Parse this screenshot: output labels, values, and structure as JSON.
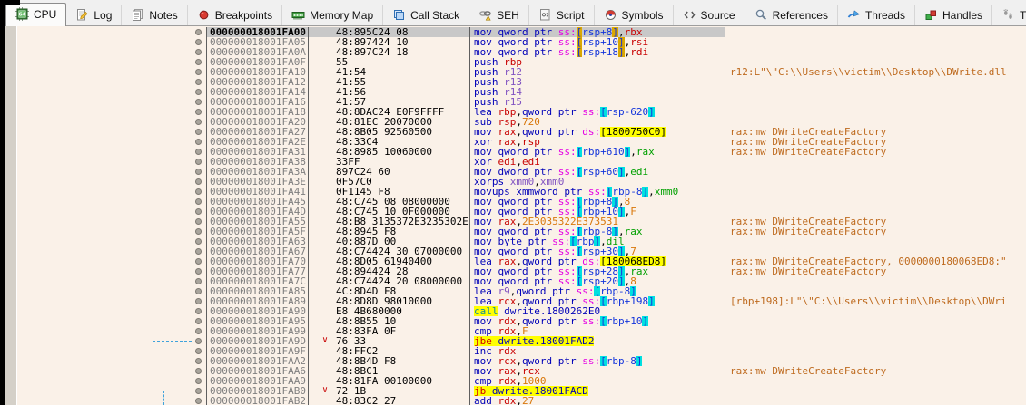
{
  "app": "x64dbg debugger - CPU disassembly view",
  "colors": {
    "pane_bg": "#FAF1E8",
    "selection_bg": "#C8C8C8",
    "comment_text": "#BE6A1E",
    "highlight_yellow": "#FFFF00",
    "bracket_gold": "#DBA800",
    "bracket_cyan": "#00E0E0",
    "jump_line_blue": "#3FA3DC",
    "jump_arrow_red": "#C80000",
    "register_red": "#C80000",
    "register_green": "#00A000",
    "register_purple": "#8153C1",
    "mnemonic_blue": "#0000B8",
    "segment_magenta": "#E400E4",
    "number_orange": "#D9770A"
  },
  "tabs": [
    {
      "label": "CPU",
      "icon": "cpu-icon",
      "active": true
    },
    {
      "label": "Log",
      "icon": "log-icon",
      "active": false
    },
    {
      "label": "Notes",
      "icon": "notes-icon",
      "active": false
    },
    {
      "label": "Breakpoints",
      "icon": "breakpoints-icon",
      "active": false
    },
    {
      "label": "Memory Map",
      "icon": "memory-map-icon",
      "active": false
    },
    {
      "label": "Call Stack",
      "icon": "call-stack-icon",
      "active": false
    },
    {
      "label": "SEH",
      "icon": "seh-icon",
      "active": false
    },
    {
      "label": "Script",
      "icon": "script-icon",
      "active": false
    },
    {
      "label": "Symbols",
      "icon": "symbols-icon",
      "active": false
    },
    {
      "label": "Source",
      "icon": "source-icon",
      "active": false
    },
    {
      "label": "References",
      "icon": "references-icon",
      "active": false
    },
    {
      "label": "Threads",
      "icon": "threads-icon",
      "active": false
    },
    {
      "label": "Handles",
      "icon": "handles-icon",
      "active": false
    },
    {
      "label": "Trace",
      "icon": "trace-icon",
      "active": false
    }
  ],
  "disasm": {
    "rows": [
      {
        "a": "000000018001FA00",
        "b": "48:895C24 08",
        "sel": true,
        "t": [
          [
            "mn",
            "mov qword ptr "
          ],
          [
            "sg",
            "ss:"
          ],
          [
            "gb",
            "["
          ],
          [
            "br",
            "rsp+8"
          ],
          [
            "gb",
            "]"
          ],
          [
            "pl",
            ","
          ],
          [
            "rr",
            "rbx"
          ]
        ],
        "c": ""
      },
      {
        "a": "000000018001FA05",
        "b": "48:897424 10",
        "t": [
          [
            "mn",
            "mov qword ptr "
          ],
          [
            "sg",
            "ss:"
          ],
          [
            "gb",
            "["
          ],
          [
            "br",
            "rsp+10"
          ],
          [
            "gb",
            "]"
          ],
          [
            "pl",
            ","
          ],
          [
            "rr",
            "rsi"
          ]
        ],
        "c": ""
      },
      {
        "a": "000000018001FA0A",
        "b": "48:897C24 18",
        "t": [
          [
            "mn",
            "mov qword ptr "
          ],
          [
            "sg",
            "ss:"
          ],
          [
            "gb",
            "["
          ],
          [
            "br",
            "rsp+18"
          ],
          [
            "gb",
            "]"
          ],
          [
            "pl",
            ","
          ],
          [
            "rr",
            "rdi"
          ]
        ],
        "c": ""
      },
      {
        "a": "000000018001FA0F",
        "b": "55",
        "t": [
          [
            "mn",
            "push "
          ],
          [
            "rr",
            "rbp"
          ]
        ],
        "c": ""
      },
      {
        "a": "000000018001FA10",
        "b": "41:54",
        "t": [
          [
            "mn",
            "push "
          ],
          [
            "rp",
            "r12"
          ]
        ],
        "c": "r12:L\"\\\"C:\\\\Users\\\\victim\\\\Desktop\\\\DWrite.dll"
      },
      {
        "a": "000000018001FA12",
        "b": "41:55",
        "t": [
          [
            "mn",
            "push "
          ],
          [
            "rp",
            "r13"
          ]
        ],
        "c": ""
      },
      {
        "a": "000000018001FA14",
        "b": "41:56",
        "t": [
          [
            "mn",
            "push "
          ],
          [
            "rp",
            "r14"
          ]
        ],
        "c": ""
      },
      {
        "a": "000000018001FA16",
        "b": "41:57",
        "t": [
          [
            "mn",
            "push "
          ],
          [
            "rp",
            "r15"
          ]
        ],
        "c": ""
      },
      {
        "a": "000000018001FA18",
        "b": "48:8DAC24 E0F9FFFF",
        "t": [
          [
            "mn",
            "lea "
          ],
          [
            "rr",
            "rbp"
          ],
          [
            "pl",
            ","
          ],
          [
            "mn",
            "qword ptr "
          ],
          [
            "sg",
            "ss:"
          ],
          [
            "cb",
            "["
          ],
          [
            "br",
            "rsp-620"
          ],
          [
            "cb",
            "]"
          ]
        ],
        "c": ""
      },
      {
        "a": "000000018001FA20",
        "b": "48:81EC 20070000",
        "t": [
          [
            "mn",
            "sub "
          ],
          [
            "rr",
            "rsp"
          ],
          [
            "pl",
            ","
          ],
          [
            "nm",
            "720"
          ]
        ],
        "c": ""
      },
      {
        "a": "000000018001FA27",
        "b": "48:8B05 92560500",
        "t": [
          [
            "mn",
            "mov "
          ],
          [
            "rr",
            "rax"
          ],
          [
            "pl",
            ","
          ],
          [
            "mn",
            "qword ptr "
          ],
          [
            "sg",
            "ds:"
          ],
          [
            "my",
            "[1800750C0]"
          ]
        ],
        "c": "rax:mw_DWriteCreateFactory"
      },
      {
        "a": "000000018001FA2E",
        "b": "48:33C4",
        "t": [
          [
            "mn",
            "xor "
          ],
          [
            "rr",
            "rax"
          ],
          [
            "pl",
            ","
          ],
          [
            "rr",
            "rsp"
          ]
        ],
        "c": "rax:mw_DWriteCreateFactory"
      },
      {
        "a": "000000018001FA31",
        "b": "48:8985 10060000",
        "t": [
          [
            "mn",
            "mov qword ptr "
          ],
          [
            "sg",
            "ss:"
          ],
          [
            "cb",
            "["
          ],
          [
            "br",
            "rbp+610"
          ],
          [
            "cb",
            "]"
          ],
          [
            "pl",
            ","
          ],
          [
            "rg",
            "rax"
          ]
        ],
        "c": "rax:mw_DWriteCreateFactory"
      },
      {
        "a": "000000018001FA38",
        "b": "33FF",
        "t": [
          [
            "mn",
            "xor "
          ],
          [
            "rr",
            "edi"
          ],
          [
            "pl",
            ","
          ],
          [
            "rr",
            "edi"
          ]
        ],
        "c": ""
      },
      {
        "a": "000000018001FA3A",
        "b": "897C24 60",
        "t": [
          [
            "mn",
            "mov dword ptr "
          ],
          [
            "sg",
            "ss:"
          ],
          [
            "cb",
            "["
          ],
          [
            "br",
            "rsp+60"
          ],
          [
            "cb",
            "]"
          ],
          [
            "pl",
            ","
          ],
          [
            "rg",
            "edi"
          ]
        ],
        "c": ""
      },
      {
        "a": "000000018001FA3E",
        "b": "0F57C0",
        "t": [
          [
            "mn",
            "xorps "
          ],
          [
            "rp",
            "xmm0"
          ],
          [
            "pl",
            ","
          ],
          [
            "rp",
            "xmm0"
          ]
        ],
        "c": ""
      },
      {
        "a": "000000018001FA41",
        "b": "0F1145 F8",
        "t": [
          [
            "mn",
            "movups xmmword ptr "
          ],
          [
            "sg",
            "ss:"
          ],
          [
            "cb",
            "["
          ],
          [
            "br",
            "rbp-8"
          ],
          [
            "cb",
            "]"
          ],
          [
            "pl",
            ","
          ],
          [
            "rg",
            "xmm0"
          ]
        ],
        "c": ""
      },
      {
        "a": "000000018001FA45",
        "b": "48:C745 08 08000000",
        "t": [
          [
            "mn",
            "mov qword ptr "
          ],
          [
            "sg",
            "ss:"
          ],
          [
            "cb",
            "["
          ],
          [
            "br",
            "rbp+8"
          ],
          [
            "cb",
            "]"
          ],
          [
            "pl",
            ","
          ],
          [
            "nm",
            "8"
          ]
        ],
        "c": ""
      },
      {
        "a": "000000018001FA4D",
        "b": "48:C745 10 0F000000",
        "t": [
          [
            "mn",
            "mov qword ptr "
          ],
          [
            "sg",
            "ss:"
          ],
          [
            "cb",
            "["
          ],
          [
            "br",
            "rbp+10"
          ],
          [
            "cb",
            "]"
          ],
          [
            "pl",
            ","
          ],
          [
            "nm",
            "F"
          ]
        ],
        "c": ""
      },
      {
        "a": "000000018001FA55",
        "b": "48:B8 3135372E3235302E",
        "t": [
          [
            "mn",
            "mov "
          ],
          [
            "rr",
            "rax"
          ],
          [
            "pl",
            ","
          ],
          [
            "nm",
            "2E3035322E373531"
          ]
        ],
        "c": "rax:mw_DWriteCreateFactory"
      },
      {
        "a": "000000018001FA5F",
        "b": "48:8945 F8",
        "t": [
          [
            "mn",
            "mov qword ptr "
          ],
          [
            "sg",
            "ss:"
          ],
          [
            "cb",
            "["
          ],
          [
            "br",
            "rbp-8"
          ],
          [
            "cb",
            "]"
          ],
          [
            "pl",
            ","
          ],
          [
            "rg",
            "rax"
          ]
        ],
        "c": "rax:mw_DWriteCreateFactory"
      },
      {
        "a": "000000018001FA63",
        "b": "40:887D 00",
        "t": [
          [
            "mn",
            "mov byte ptr "
          ],
          [
            "sg",
            "ss:"
          ],
          [
            "cb",
            "["
          ],
          [
            "br",
            "rbp"
          ],
          [
            "cb",
            "]"
          ],
          [
            "pl",
            ","
          ],
          [
            "rg",
            "dil"
          ]
        ],
        "c": ""
      },
      {
        "a": "000000018001FA67",
        "b": "48:C74424 30 07000000",
        "t": [
          [
            "mn",
            "mov qword ptr "
          ],
          [
            "sg",
            "ss:"
          ],
          [
            "cb",
            "["
          ],
          [
            "br",
            "rsp+30"
          ],
          [
            "cb",
            "]"
          ],
          [
            "pl",
            ","
          ],
          [
            "nm",
            "7"
          ]
        ],
        "c": ""
      },
      {
        "a": "000000018001FA70",
        "b": "48:8D05 61940400",
        "t": [
          [
            "mn",
            "lea "
          ],
          [
            "rr",
            "rax"
          ],
          [
            "pl",
            ","
          ],
          [
            "mn",
            "qword ptr "
          ],
          [
            "sg",
            "ds:"
          ],
          [
            "my",
            "[180068ED8]"
          ]
        ],
        "c": "rax:mw_DWriteCreateFactory, 0000000180068ED8:\""
      },
      {
        "a": "000000018001FA77",
        "b": "48:894424 28",
        "t": [
          [
            "mn",
            "mov qword ptr "
          ],
          [
            "sg",
            "ss:"
          ],
          [
            "cb",
            "["
          ],
          [
            "br",
            "rsp+28"
          ],
          [
            "cb",
            "]"
          ],
          [
            "pl",
            ","
          ],
          [
            "rg",
            "rax"
          ]
        ],
        "c": "rax:mw_DWriteCreateFactory"
      },
      {
        "a": "000000018001FA7C",
        "b": "48:C74424 20 08000000",
        "t": [
          [
            "mn",
            "mov qword ptr "
          ],
          [
            "sg",
            "ss:"
          ],
          [
            "cb",
            "["
          ],
          [
            "br",
            "rsp+20"
          ],
          [
            "cb",
            "]"
          ],
          [
            "pl",
            ","
          ],
          [
            "nm",
            "8"
          ]
        ],
        "c": ""
      },
      {
        "a": "000000018001FA85",
        "b": "4C:8D4D F8",
        "t": [
          [
            "mn",
            "lea "
          ],
          [
            "rp",
            "r9"
          ],
          [
            "pl",
            ","
          ],
          [
            "mn",
            "qword ptr "
          ],
          [
            "sg",
            "ss:"
          ],
          [
            "cb",
            "["
          ],
          [
            "br",
            "rbp-8"
          ],
          [
            "cb",
            "]"
          ]
        ],
        "c": ""
      },
      {
        "a": "000000018001FA89",
        "b": "48:8D8D 98010000",
        "t": [
          [
            "mn",
            "lea "
          ],
          [
            "rr",
            "rcx"
          ],
          [
            "pl",
            ","
          ],
          [
            "mn",
            "qword ptr "
          ],
          [
            "sg",
            "ss:"
          ],
          [
            "cb",
            "["
          ],
          [
            "br",
            "rbp+198"
          ],
          [
            "cb",
            "]"
          ]
        ],
        "c": "[rbp+198]:L\"\\\"C:\\\\Users\\\\victim\\\\Desktop\\\\DWri"
      },
      {
        "a": "000000018001FA90",
        "b": "E8 4B680000",
        "t": [
          [
            "cm",
            "call"
          ],
          [
            "pl",
            " "
          ],
          [
            "lb",
            "dwrite.1800262E0"
          ]
        ],
        "c": ""
      },
      {
        "a": "000000018001FA95",
        "b": "48:8B55 10",
        "t": [
          [
            "mn",
            "mov "
          ],
          [
            "rr",
            "rdx"
          ],
          [
            "pl",
            ","
          ],
          [
            "mn",
            "qword ptr "
          ],
          [
            "sg",
            "ss:"
          ],
          [
            "cb",
            "["
          ],
          [
            "br",
            "rbp+10"
          ],
          [
            "cb",
            "]"
          ]
        ],
        "c": ""
      },
      {
        "a": "000000018001FA99",
        "b": "48:83FA 0F",
        "t": [
          [
            "mn",
            "cmp "
          ],
          [
            "rr",
            "rdx"
          ],
          [
            "pl",
            ","
          ],
          [
            "nm",
            "F"
          ]
        ],
        "c": ""
      },
      {
        "a": "000000018001FA9D",
        "b": "76 33",
        "ar": true,
        "t": [
          [
            "jc",
            "jbe"
          ],
          [
            "yp",
            " "
          ],
          [
            "jl",
            "dwrite.18001FAD2"
          ]
        ],
        "c": ""
      },
      {
        "a": "000000018001FA9F",
        "b": "48:FFC2",
        "t": [
          [
            "mn",
            "inc "
          ],
          [
            "rr",
            "rdx"
          ]
        ],
        "c": ""
      },
      {
        "a": "000000018001FAA2",
        "b": "48:8B4D F8",
        "t": [
          [
            "mn",
            "mov "
          ],
          [
            "rr",
            "rcx"
          ],
          [
            "pl",
            ","
          ],
          [
            "mn",
            "qword ptr "
          ],
          [
            "sg",
            "ss:"
          ],
          [
            "cb",
            "["
          ],
          [
            "br",
            "rbp-8"
          ],
          [
            "cb",
            "]"
          ]
        ],
        "c": ""
      },
      {
        "a": "000000018001FAA6",
        "b": "48:8BC1",
        "t": [
          [
            "mn",
            "mov "
          ],
          [
            "rr",
            "rax"
          ],
          [
            "pl",
            ","
          ],
          [
            "rr",
            "rcx"
          ]
        ],
        "c": "rax:mw_DWriteCreateFactory"
      },
      {
        "a": "000000018001FAA9",
        "b": "48:81FA 00100000",
        "t": [
          [
            "mn",
            "cmp "
          ],
          [
            "rr",
            "rdx"
          ],
          [
            "pl",
            ","
          ],
          [
            "nm",
            "1000"
          ]
        ],
        "c": ""
      },
      {
        "a": "000000018001FAB0",
        "b": "72 1B",
        "ar": true,
        "t": [
          [
            "jc",
            "jb"
          ],
          [
            "yp",
            " "
          ],
          [
            "jl",
            "dwrite.18001FACD"
          ]
        ],
        "c": ""
      },
      {
        "a": "000000018001FAB2",
        "b": "48:83C2 27",
        "t": [
          [
            "mn",
            "add "
          ],
          [
            "rr",
            "rdx"
          ],
          [
            "pl",
            ","
          ],
          [
            "nm",
            "27"
          ]
        ],
        "c": ""
      }
    ]
  }
}
